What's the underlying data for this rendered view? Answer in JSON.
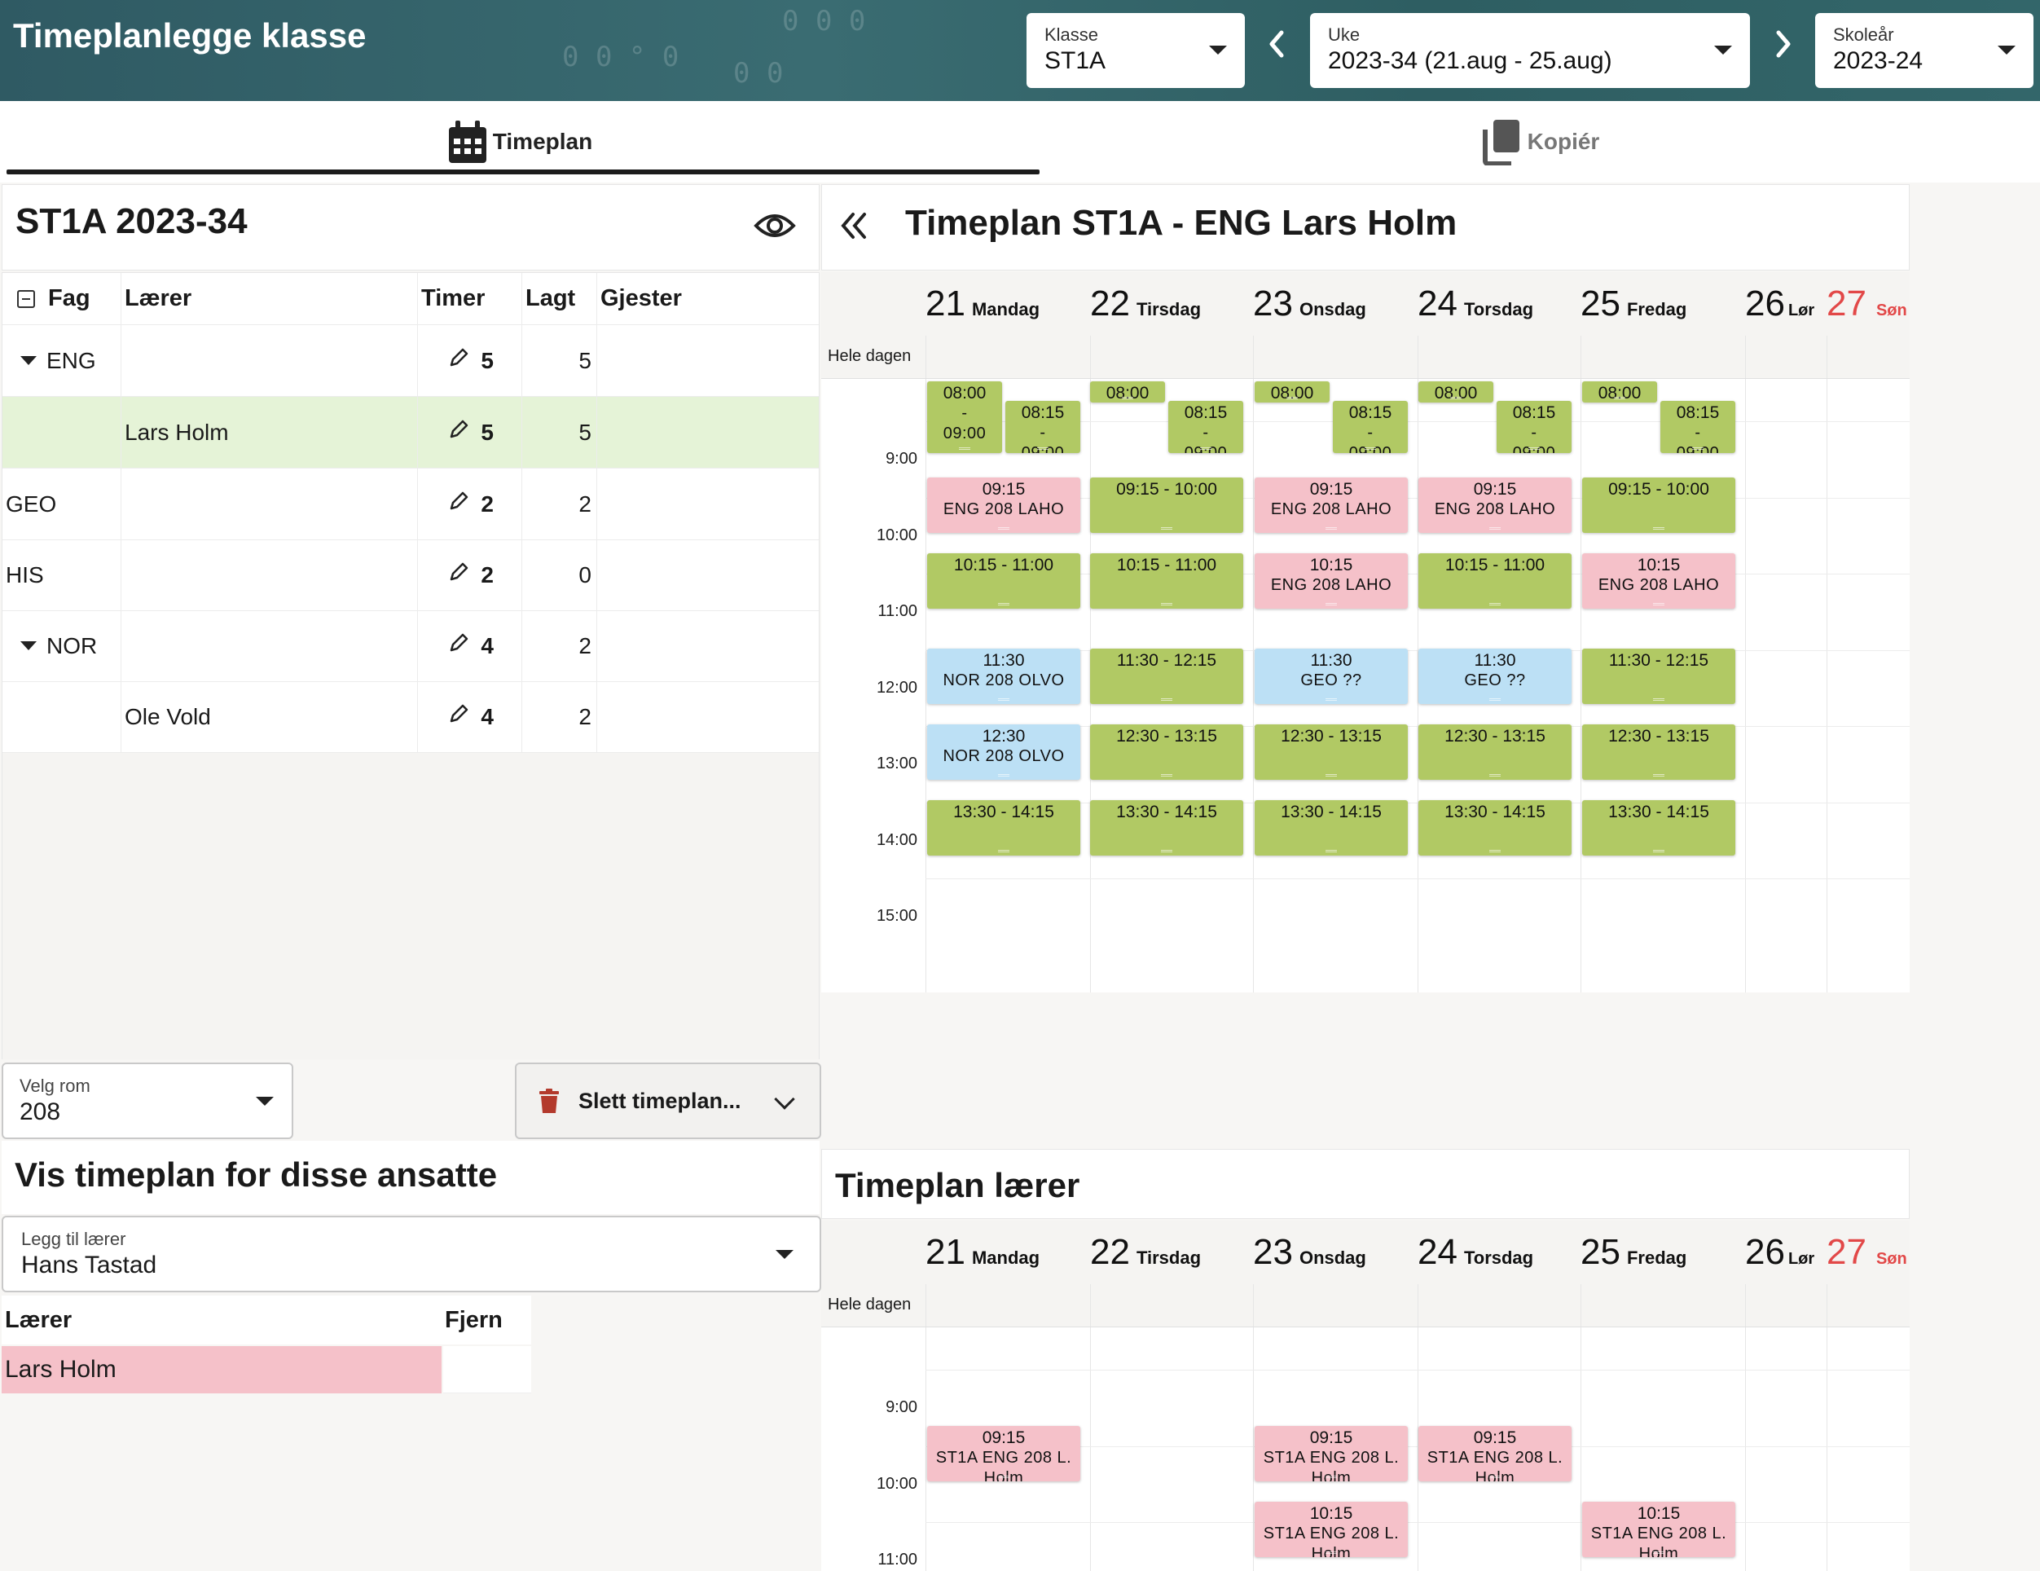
{
  "header": {
    "title": "Timeplanlegge klasse",
    "klasse": {
      "label": "Klasse",
      "value": "ST1A"
    },
    "uke": {
      "label": "Uke",
      "value": "2023-34 (21.aug - 25.aug)"
    },
    "skolear": {
      "label": "Skoleår",
      "value": "2023-24"
    }
  },
  "tabs": {
    "timeplan": "Timeplan",
    "kopier": "Kopiér"
  },
  "left": {
    "title": "ST1A 2023-34",
    "columns": {
      "fag": "Fag",
      "laerer": "Lærer",
      "timer": "Timer",
      "lagt": "Lagt",
      "gjester": "Gjester"
    },
    "rows": [
      {
        "fag": "ENG",
        "laerer": "",
        "timer": "5",
        "lagt": "5"
      },
      {
        "fag": "",
        "laerer": "Lars Holm",
        "timer": "5",
        "lagt": "5"
      },
      {
        "fag": "GEO",
        "laerer": "",
        "timer": "2",
        "lagt": "2"
      },
      {
        "fag": "HIS",
        "laerer": "",
        "timer": "2",
        "lagt": "0"
      },
      {
        "fag": "NOR",
        "laerer": "",
        "timer": "4",
        "lagt": "2"
      },
      {
        "fag": "",
        "laerer": "Ole Vold",
        "timer": "4",
        "lagt": "2"
      }
    ],
    "room": {
      "label": "Velg rom",
      "value": "208"
    },
    "delete_label": "Slett timeplan...",
    "show_title": "Vis timeplan for disse ansatte",
    "add_teacher": {
      "label": "Legg til lærer",
      "value": "Hans Tastad"
    },
    "teacher_table": {
      "col_laerer": "Lærer",
      "col_fjern": "Fjern",
      "rows": [
        {
          "name": "Lars Holm"
        }
      ]
    }
  },
  "calendar": {
    "title": "Timeplan ST1A - ENG Lars Holm",
    "allday": "Hele dagen",
    "days": [
      {
        "num": "21",
        "name": "Mandag"
      },
      {
        "num": "22",
        "name": "Tirsdag"
      },
      {
        "num": "23",
        "name": "Onsdag"
      },
      {
        "num": "24",
        "name": "Torsdag"
      },
      {
        "num": "25",
        "name": "Fredag"
      },
      {
        "num": "26",
        "name": "Lør"
      },
      {
        "num": "27",
        "name": "Søn"
      }
    ],
    "hours": [
      "9:00",
      "10:00",
      "11:00",
      "12:00",
      "13:00",
      "14:00",
      "15:00"
    ],
    "events": [
      {
        "line1": "08:00",
        "line2": "-",
        "line3": "09:00"
      },
      {
        "line1": "08:15",
        "line2": "-",
        "line3": "09:00"
      },
      {
        "line1": "08:00"
      },
      {
        "line1": "08:15",
        "line2": "-",
        "line3": "09:00"
      },
      {
        "line1": "08:00"
      },
      {
        "line1": "08:15",
        "line2": "-",
        "line3": "09:00"
      },
      {
        "line1": "08:00"
      },
      {
        "line1": "08:15",
        "line2": "-",
        "line3": "09:00"
      },
      {
        "line1": "08:00"
      },
      {
        "line1": "08:15",
        "line2": "-",
        "line3": "09:00"
      },
      {
        "line1": "09:15",
        "line2": "ENG 208 LAHO"
      },
      {
        "line1": "09:15 - 10:00"
      },
      {
        "line1": "09:15",
        "line2": "ENG 208 LAHO"
      },
      {
        "line1": "09:15",
        "line2": "ENG 208 LAHO"
      },
      {
        "line1": "09:15 - 10:00"
      },
      {
        "line1": "10:15 - 11:00"
      },
      {
        "line1": "10:15 - 11:00"
      },
      {
        "line1": "10:15",
        "line2": "ENG 208 LAHO"
      },
      {
        "line1": "10:15 - 11:00"
      },
      {
        "line1": "10:15",
        "line2": "ENG 208 LAHO"
      },
      {
        "line1": "11:30",
        "line2": "NOR 208 OLVO"
      },
      {
        "line1": "11:30 - 12:15"
      },
      {
        "line1": "11:30",
        "line2": "GEO ??"
      },
      {
        "line1": "11:30",
        "line2": "GEO ??"
      },
      {
        "line1": "11:30 - 12:15"
      },
      {
        "line1": "12:30",
        "line2": "NOR 208 OLVO"
      },
      {
        "line1": "12:30 - 13:15"
      },
      {
        "line1": "12:30 - 13:15"
      },
      {
        "line1": "12:30 - 13:15"
      },
      {
        "line1": "12:30 - 13:15"
      },
      {
        "line1": "13:30 - 14:15"
      },
      {
        "line1": "13:30 - 14:15"
      },
      {
        "line1": "13:30 - 14:15"
      },
      {
        "line1": "13:30 - 14:15"
      },
      {
        "line1": "13:30 - 14:15"
      }
    ]
  },
  "teacher_calendar": {
    "title": "Timeplan lærer",
    "allday": "Hele dagen",
    "hours": [
      "9:00",
      "10:00",
      "11:00"
    ],
    "events": [
      {
        "line1": "09:15",
        "line2": "ST1A ENG 208 L.",
        "line3": "Holm"
      },
      {
        "line1": "09:15",
        "line2": "ST1A ENG 208 L.",
        "line3": "Holm"
      },
      {
        "line1": "09:15",
        "line2": "ST1A ENG 208 L.",
        "line3": "Holm"
      },
      {
        "line1": "10:15",
        "line2": "ST1A ENG 208 L.",
        "line3": "Holm"
      },
      {
        "line1": "10:15",
        "line2": "ST1A ENG 208 L.",
        "line3": "Holm"
      }
    ]
  },
  "colors": {
    "green": "#b1c964",
    "pink": "#f5c1c9",
    "blue": "#bce0f5",
    "weekend_red": "#e24848",
    "selected_row": "#e5f3d7"
  }
}
